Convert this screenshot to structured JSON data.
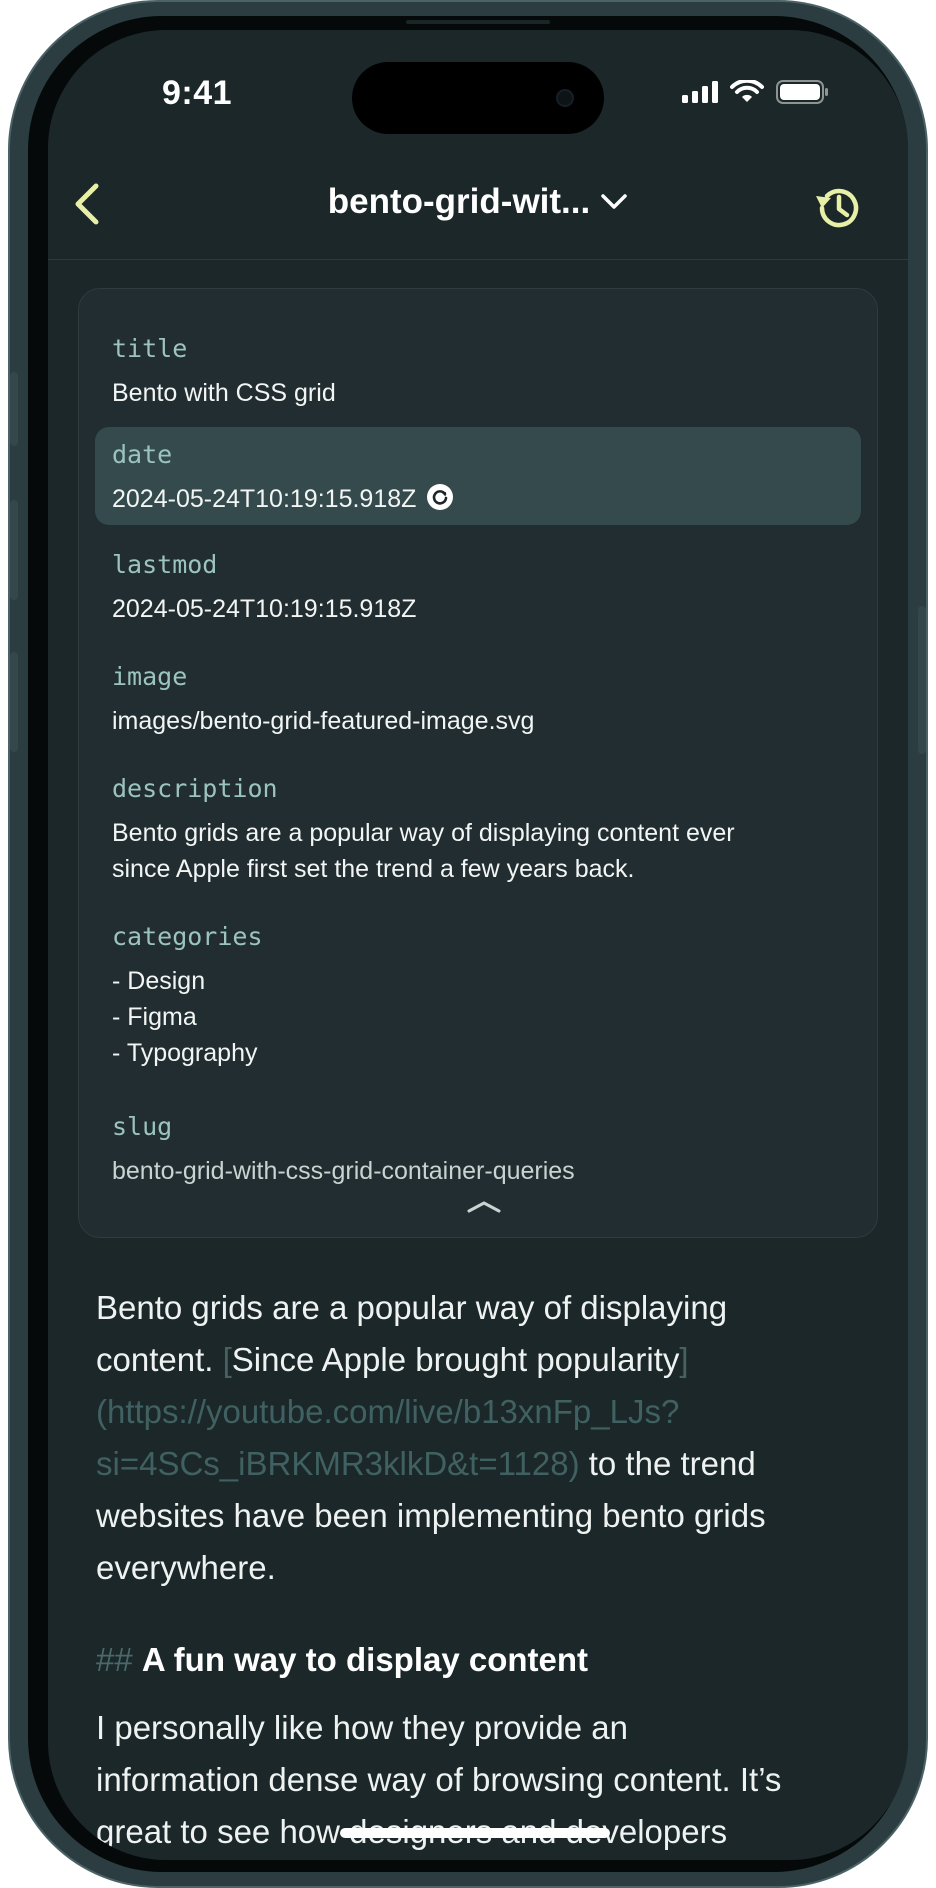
{
  "status_bar": {
    "time": "9:41"
  },
  "nav": {
    "title": "bento-grid-wit...",
    "back_icon": "chevron-left-icon",
    "history_icon": "history-icon",
    "accent_color": "#e8f0a8"
  },
  "frontmatter": {
    "title": {
      "key": "title",
      "value": "Bento with CSS grid"
    },
    "date": {
      "key": "date",
      "value": "2024-05-24T10:19:15.918Z"
    },
    "lastmod": {
      "key": "lastmod",
      "value": "2024-05-24T10:19:15.918Z"
    },
    "image": {
      "key": "image",
      "value": "images/bento-grid-featured-image.svg"
    },
    "description": {
      "key": "description",
      "line1": "Bento grids are a popular way of displaying content ever",
      "line2": "since Apple first set the trend a few years back."
    },
    "categories": {
      "key": "categories",
      "items": [
        "Design",
        "Figma",
        "Typography"
      ]
    },
    "slug": {
      "key": "slug",
      "value": "bento-grid-with-css-grid-container-queries"
    }
  },
  "body": {
    "p1_line1": "Bento grids are a popular way of displaying",
    "p1_line2_text": "content. ",
    "link_open": "[",
    "link_text": "Since Apple brought popularity",
    "link_close": "]",
    "link_url_line1": "(https://youtube.com/live/b13xnFp_LJs?",
    "link_url_line2": "si=4SCs_iBRKMR3klkD&t=1128)",
    "p1_line4_rest": " to the trend",
    "p1_line5": "websites have been implementing bento grids",
    "p1_line6": "everywhere.",
    "heading_marker": "##",
    "heading_text": "A fun way to display content",
    "p2_line1": "I personally like how they provide an",
    "p2_line2": "information dense way of browsing content. It’s",
    "p2_line3": "great to see how designers and developers"
  },
  "colors": {
    "background": "#1c2729",
    "card": "#212d30",
    "active_row": "#344a4d",
    "key_text": "#9cc4bf",
    "link_text": "#3f6161"
  }
}
